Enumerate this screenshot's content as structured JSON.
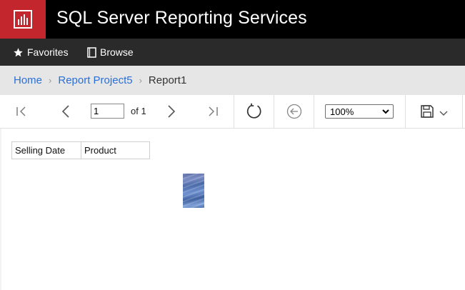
{
  "app": {
    "title": "SQL Server Reporting Services",
    "brand_color": "#c4262e"
  },
  "nav": {
    "favorites_label": "Favorites",
    "browse_label": "Browse"
  },
  "breadcrumb": {
    "home": "Home",
    "project": "Report Project5",
    "current": "Report1"
  },
  "toolbar": {
    "page_value": "1",
    "page_of": "of 1",
    "zoom_value": "100%",
    "icons": [
      "first-page-icon",
      "previous-page-icon",
      "next-page-icon",
      "last-page-icon",
      "refresh-icon",
      "back-icon",
      "save-icon",
      "chevron-down-icon"
    ]
  },
  "report": {
    "columns": [
      "Selling Date",
      "Product"
    ]
  }
}
